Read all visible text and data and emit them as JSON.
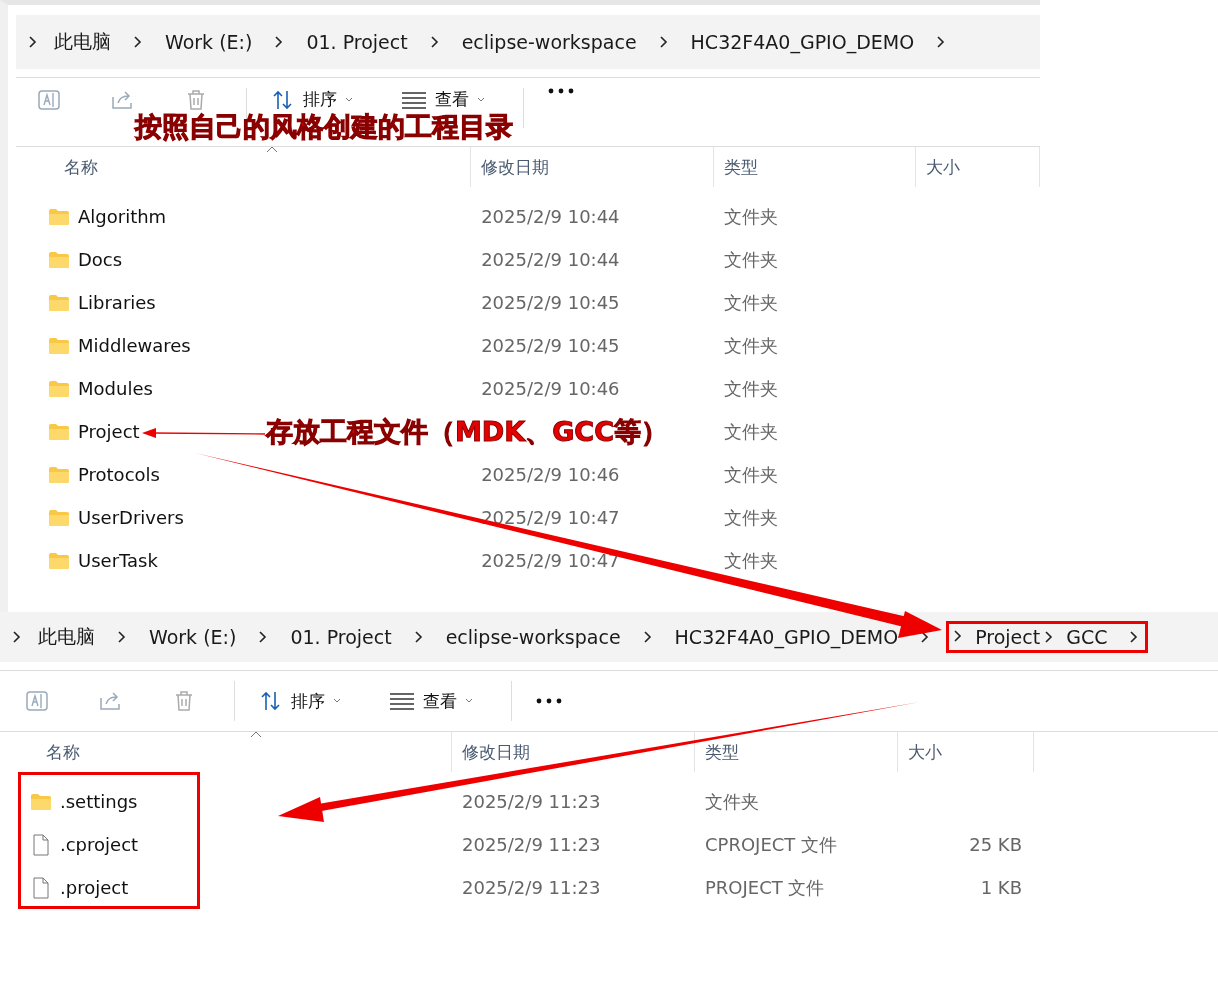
{
  "explorers": [
    {
      "breadcrumb": [
        {
          "label": "此电脑",
          "boxed": false
        },
        {
          "label": "Work (E:)",
          "boxed": false
        },
        {
          "label": "01. Project",
          "boxed": false
        },
        {
          "label": "eclipse-workspace",
          "boxed": false
        },
        {
          "label": "HC32F4A0_GPIO_DEMO",
          "boxed": false
        }
      ],
      "toolbar": {
        "sort": "排序",
        "view": "查看"
      },
      "columns": [
        "名称",
        "修改日期",
        "类型",
        "大小"
      ],
      "rows": [
        {
          "kind": "folder",
          "name": "Algorithm",
          "date": "2025/2/9 10:44",
          "type": "文件夹",
          "boxed": false
        },
        {
          "kind": "folder",
          "name": "Docs",
          "date": "2025/2/9 10:44",
          "type": "文件夹",
          "boxed": false
        },
        {
          "kind": "folder",
          "name": "Libraries",
          "date": "2025/2/9 10:45",
          "type": "文件夹",
          "boxed": false
        },
        {
          "kind": "folder",
          "name": "Middlewares",
          "date": "2025/2/9 10:45",
          "type": "文件夹",
          "boxed": false
        },
        {
          "kind": "folder",
          "name": "Modules",
          "date": "2025/2/9 10:46",
          "type": "文件夹",
          "boxed": false
        },
        {
          "kind": "folder",
          "name": "Project",
          "type": "文件夹",
          "boxed": false
        },
        {
          "kind": "folder",
          "name": "Protocols",
          "date": "2025/2/9 10:46",
          "type": "文件夹",
          "boxed": false
        },
        {
          "kind": "folder",
          "name": "UserDrivers",
          "date": "2025/2/9 10:47",
          "type": "文件夹",
          "boxed": false
        },
        {
          "kind": "folder",
          "name": "UserTask",
          "date": "2025/2/9 10:47",
          "type": "文件夹",
          "boxed": false
        }
      ]
    },
    {
      "breadcrumb": [
        {
          "label": "此电脑",
          "boxed": false
        },
        {
          "label": "Work (E:)",
          "boxed": false
        },
        {
          "label": "01. Project",
          "boxed": false
        },
        {
          "label": "eclipse-workspace",
          "boxed": false
        },
        {
          "label": "HC32F4A0_GPIO_DEMO",
          "boxed": false
        },
        {
          "label": "Project",
          "boxed": true
        },
        {
          "label": "GCC",
          "boxed": true
        }
      ],
      "toolbar": {
        "sort": "排序",
        "view": "查看"
      },
      "columns": [
        "名称",
        "修改日期",
        "类型",
        "大小"
      ],
      "rows": [
        {
          "kind": "folder",
          "name": ".settings",
          "date": "2025/2/9 11:23",
          "type": "文件夹",
          "boxed": true
        },
        {
          "kind": "file",
          "name": ".cproject",
          "date": "2025/2/9 11:23",
          "type": "CPROJECT 文件",
          "size": "25 KB",
          "boxed": true
        },
        {
          "kind": "file",
          "name": ".project",
          "date": "2025/2/9 11:23",
          "type": "PROJECT 文件",
          "size": "1 KB",
          "boxed": true
        }
      ]
    }
  ],
  "annotations": [
    {
      "text": "按照自己的风格创建的工程目录"
    },
    {
      "text": "存放工程文件（MDK、GCC等）"
    }
  ]
}
